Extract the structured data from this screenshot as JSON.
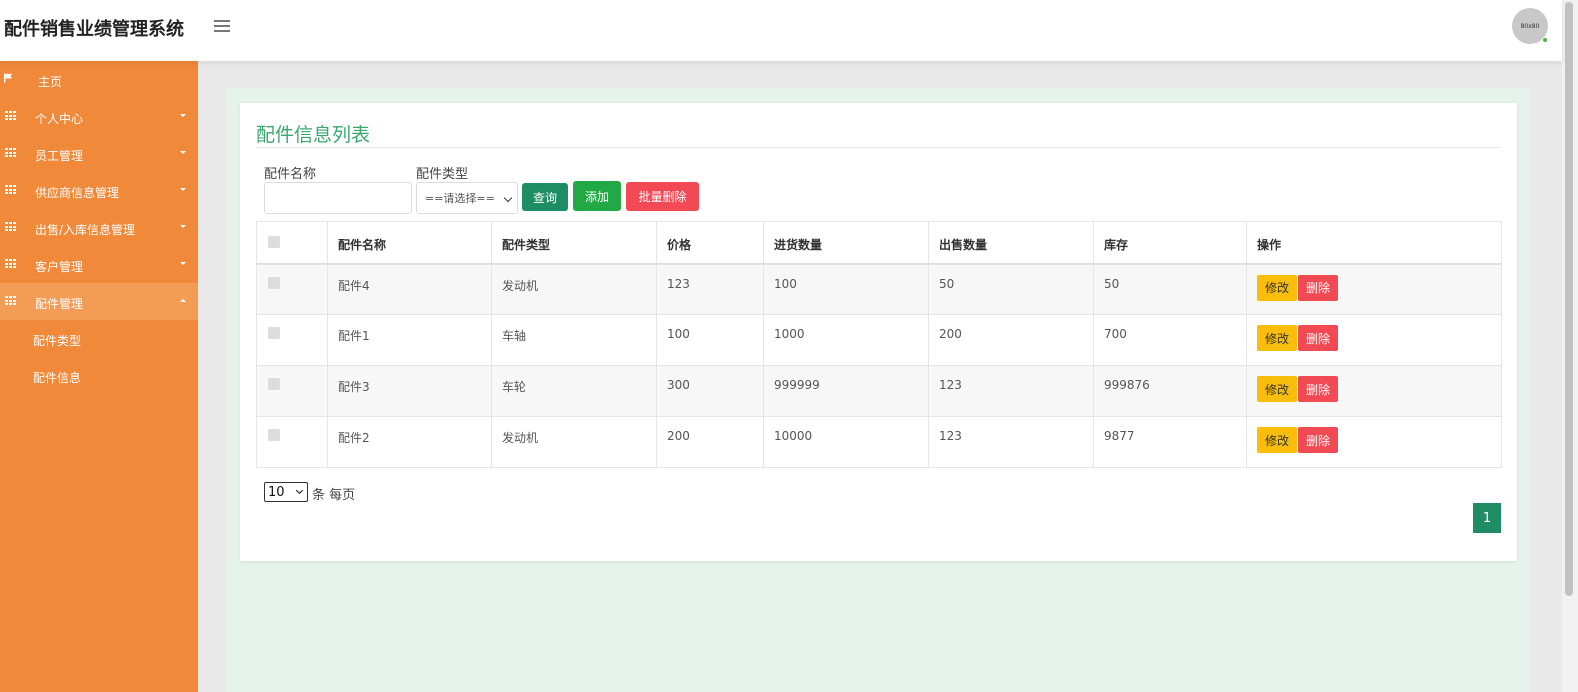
{
  "header": {
    "brand": "配件销售业绩管理系统",
    "avatar_text": "80x80"
  },
  "sidebar": {
    "items": [
      {
        "label": "主页",
        "icon": "flag-icon"
      },
      {
        "label": "个人中心",
        "icon": "grid-icon"
      },
      {
        "label": "员工管理",
        "icon": "grid-icon"
      },
      {
        "label": "供应商信息管理",
        "icon": "grid-icon"
      },
      {
        "label": "出售/入库信息管理",
        "icon": "grid-icon"
      },
      {
        "label": "客户管理",
        "icon": "grid-icon"
      },
      {
        "label": "配件管理",
        "icon": "grid-icon"
      }
    ],
    "sub_items": [
      {
        "label": "配件类型"
      },
      {
        "label": "配件信息"
      }
    ]
  },
  "card": {
    "title": "配件信息列表",
    "search": {
      "name_label": "配件名称",
      "name_value": "",
      "type_label": "配件类型",
      "type_selected": "==请选择=="
    },
    "buttons": {
      "query": "查询",
      "add": "添加",
      "bulk_delete": "批量删除"
    },
    "table": {
      "headers": [
        "配件名称",
        "配件类型",
        "价格",
        "进货数量",
        "出售数量",
        "库存",
        "操作"
      ],
      "rows": [
        {
          "name": "配件4",
          "type": "发动机",
          "price": "123",
          "purchase": "100",
          "sold": "50",
          "stock": "50"
        },
        {
          "name": "配件1",
          "type": "车轴",
          "price": "100",
          "purchase": "1000",
          "sold": "200",
          "stock": "700"
        },
        {
          "name": "配件3",
          "type": "车轮",
          "price": "300",
          "purchase": "999999",
          "sold": "123",
          "stock": "999876"
        },
        {
          "name": "配件2",
          "type": "发动机",
          "price": "200",
          "purchase": "10000",
          "sold": "123",
          "stock": "9877"
        }
      ],
      "edit_label": "修改",
      "delete_label": "删除"
    },
    "pagination": {
      "page_size": "10",
      "per_page_text": "条 每页",
      "current_page": "1"
    }
  },
  "colors": {
    "sidebar": "#f0893a",
    "accent_green": "#1e8c64",
    "add_green": "#22a845",
    "danger": "#f24a55",
    "warning": "#f9bd0b",
    "title_green": "#3aa76d"
  }
}
